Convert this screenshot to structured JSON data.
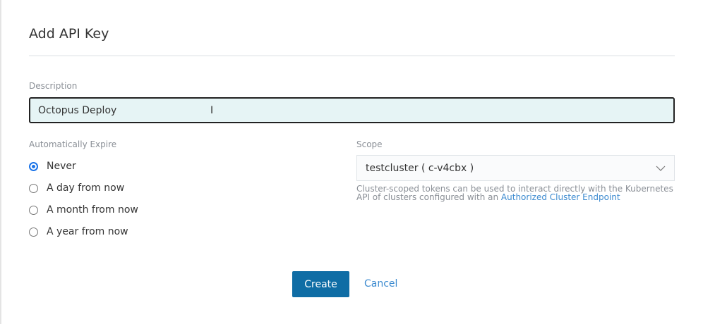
{
  "title": "Add API Key",
  "description": {
    "label": "Description",
    "value": "Octopus Deploy"
  },
  "expire": {
    "label": "Automatically Expire",
    "options": [
      "Never",
      "A day from now",
      "A month from now",
      "A year from now"
    ],
    "selected": "Never"
  },
  "scope": {
    "label": "Scope",
    "value": "testcluster ( c-v4cbx )",
    "help": "Cluster-scoped tokens can be used to interact directly with the Kubernetes API of clusters configured with an ",
    "help_link": "Authorized Cluster Endpoint"
  },
  "buttons": {
    "create": "Create",
    "cancel": "Cancel"
  },
  "colors": {
    "primary": "#0f6da5",
    "link": "#3d8bd0"
  }
}
